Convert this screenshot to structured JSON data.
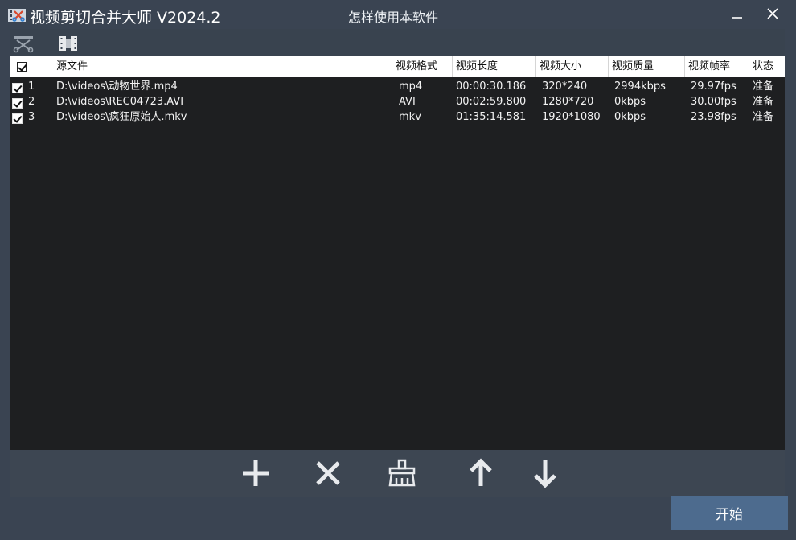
{
  "window": {
    "title": "视频剪切合并大师 V2024.2",
    "help_link": "怎样使用本软件"
  },
  "toolbar": {
    "cut_icon": "scissors-icon",
    "merge_icon": "film-merge-icon"
  },
  "table": {
    "columns": {
      "source": "源文件",
      "format": "视频格式",
      "duration": "视频长度",
      "size": "视频大小",
      "quality": "视频质量",
      "fps": "视频帧率",
      "status": "状态"
    },
    "rows": [
      {
        "num": "1",
        "source": "D:\\videos\\动物世界.mp4",
        "format": "mp4",
        "duration": "00:00:30.186",
        "size": "320*240",
        "quality": "2994kbps",
        "fps": "29.97fps",
        "status": "准备",
        "checked": true
      },
      {
        "num": "2",
        "source": "D:\\videos\\REC04723.AVI",
        "format": "AVI",
        "duration": "00:02:59.800",
        "size": "1280*720",
        "quality": "0kbps",
        "fps": "30.00fps",
        "status": "准备",
        "checked": true
      },
      {
        "num": "3",
        "source": "D:\\videos\\疯狂原始人.mkv",
        "format": "mkv",
        "duration": "01:35:14.581",
        "size": "1920*1080",
        "quality": "0kbps",
        "fps": "23.98fps",
        "status": "准备",
        "checked": true
      }
    ]
  },
  "actions": {
    "add_icon": "plus-icon",
    "delete_icon": "x-icon",
    "clear_icon": "broom-icon",
    "up_icon": "arrow-up-icon",
    "down_icon": "arrow-down-icon"
  },
  "start_button": "开始",
  "colors": {
    "chrome": "#3a4452",
    "list_bg": "#1e1f21",
    "start_button": "#4d6b8e"
  }
}
